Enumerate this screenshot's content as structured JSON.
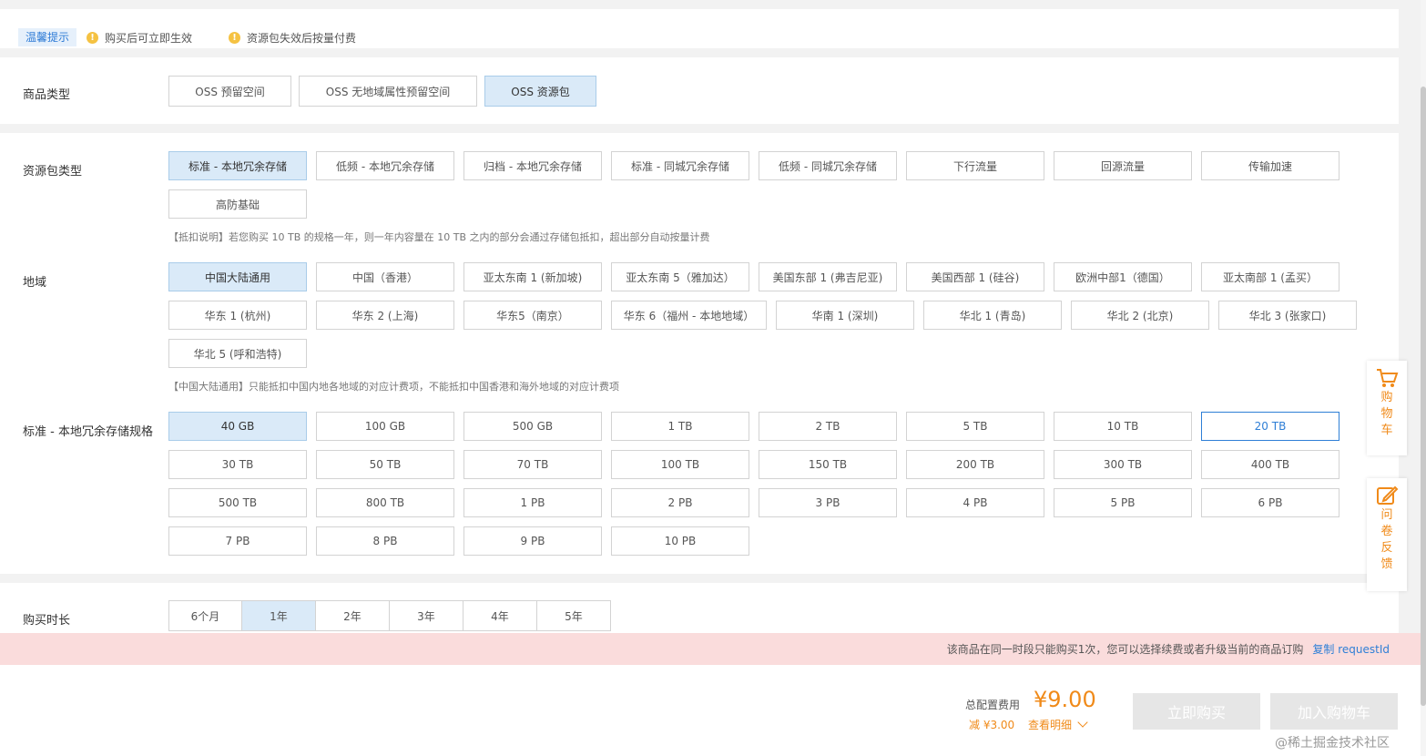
{
  "tips": {
    "tag": "温馨提示",
    "items": [
      "购买后可立即生效",
      "资源包失效后按量付费"
    ]
  },
  "product_type": {
    "label": "商品类型",
    "options": [
      "OSS 预留空间",
      "OSS 无地域属性预留空间",
      "OSS 资源包"
    ],
    "selected": "OSS 资源包"
  },
  "package_type": {
    "label": "资源包类型",
    "options": [
      "标准 - 本地冗余存储",
      "低频 - 本地冗余存储",
      "归档 - 本地冗余存储",
      "标准 - 同城冗余存储",
      "低频 - 同城冗余存储",
      "下行流量",
      "回源流量",
      "传输加速",
      "高防基础"
    ],
    "selected": "标准 - 本地冗余存储",
    "note": "【抵扣说明】若您购买 10 TB 的规格一年，则一年内容量在 10 TB 之内的部分会通过存储包抵扣，超出部分自动按量计费"
  },
  "region": {
    "label": "地域",
    "options": [
      "中国大陆通用",
      "中国（香港）",
      "亚太东南 1 (新加坡)",
      "亚太东南 5（雅加达）",
      "美国东部 1 (弗吉尼亚)",
      "美国西部 1 (硅谷)",
      "欧洲中部1（德国）",
      "亚太南部 1 (孟买）",
      "华东 1 (杭州)",
      "华东 2 (上海)",
      "华东5（南京）",
      "华东 6（福州 - 本地地域）",
      "华南 1 (深圳)",
      "华北 1 (青岛)",
      "华北 2 (北京)",
      "华北 3 (张家口)",
      "华北 5 (呼和浩特)"
    ],
    "selected": "中国大陆通用",
    "note": "【中国大陆通用】只能抵扣中国内地各地域的对应计费项，不能抵扣中国香港和海外地域的对应计费项"
  },
  "spec": {
    "label": "标准 - 本地冗余存储规格",
    "options": [
      "40 GB",
      "100 GB",
      "500 GB",
      "1 TB",
      "2 TB",
      "5 TB",
      "10 TB",
      "20 TB",
      "30 TB",
      "50 TB",
      "70 TB",
      "100 TB",
      "150 TB",
      "200 TB",
      "300 TB",
      "400 TB",
      "500 TB",
      "800 TB",
      "1 PB",
      "2 PB",
      "3 PB",
      "4 PB",
      "5 PB",
      "6 PB",
      "7 PB",
      "8 PB",
      "9 PB",
      "10 PB"
    ],
    "selected": "40 GB",
    "hovered": "20 TB"
  },
  "duration": {
    "label": "购买时长",
    "options": [
      "6个月",
      "1年",
      "2年",
      "3年",
      "4年",
      "5年"
    ],
    "selected": "1年"
  },
  "alert": {
    "text": "该商品在同一时段只能购买1次，您可以选择续费或者升级当前的商品订购",
    "link": "复制 requestId"
  },
  "footer": {
    "total_label": "总配置费用",
    "price": "¥9.00",
    "discount": "减 ¥3.00",
    "detail_link": "查看明细",
    "buy_now": "立即购买",
    "add_cart": "加入购物车",
    "watermark": "@稀土掘金技术社区"
  },
  "side": {
    "cart": "购物车",
    "survey": "问卷反馈"
  },
  "colors": {
    "accent": "#2f7fd6",
    "price": "#f08a19",
    "selected_bg": "#daeaf8",
    "alert_bg": "#fadcdc"
  }
}
